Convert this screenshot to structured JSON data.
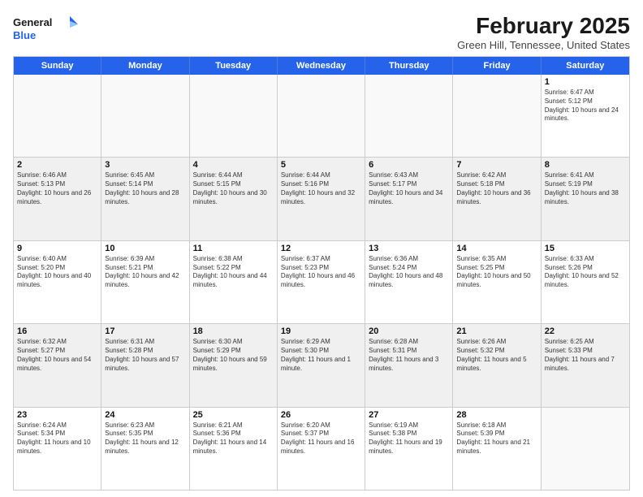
{
  "logo": {
    "general": "General",
    "blue": "Blue"
  },
  "header": {
    "title": "February 2025",
    "location": "Green Hill, Tennessee, United States"
  },
  "weekdays": [
    "Sunday",
    "Monday",
    "Tuesday",
    "Wednesday",
    "Thursday",
    "Friday",
    "Saturday"
  ],
  "rows": [
    [
      {
        "day": "",
        "empty": true
      },
      {
        "day": "",
        "empty": true
      },
      {
        "day": "",
        "empty": true
      },
      {
        "day": "",
        "empty": true
      },
      {
        "day": "",
        "empty": true
      },
      {
        "day": "",
        "empty": true
      },
      {
        "day": "1",
        "sunrise": "6:47 AM",
        "sunset": "5:12 PM",
        "daylight": "10 hours and 24 minutes."
      }
    ],
    [
      {
        "day": "2",
        "sunrise": "6:46 AM",
        "sunset": "5:13 PM",
        "daylight": "10 hours and 26 minutes."
      },
      {
        "day": "3",
        "sunrise": "6:45 AM",
        "sunset": "5:14 PM",
        "daylight": "10 hours and 28 minutes."
      },
      {
        "day": "4",
        "sunrise": "6:44 AM",
        "sunset": "5:15 PM",
        "daylight": "10 hours and 30 minutes."
      },
      {
        "day": "5",
        "sunrise": "6:44 AM",
        "sunset": "5:16 PM",
        "daylight": "10 hours and 32 minutes."
      },
      {
        "day": "6",
        "sunrise": "6:43 AM",
        "sunset": "5:17 PM",
        "daylight": "10 hours and 34 minutes."
      },
      {
        "day": "7",
        "sunrise": "6:42 AM",
        "sunset": "5:18 PM",
        "daylight": "10 hours and 36 minutes."
      },
      {
        "day": "8",
        "sunrise": "6:41 AM",
        "sunset": "5:19 PM",
        "daylight": "10 hours and 38 minutes."
      }
    ],
    [
      {
        "day": "9",
        "sunrise": "6:40 AM",
        "sunset": "5:20 PM",
        "daylight": "10 hours and 40 minutes."
      },
      {
        "day": "10",
        "sunrise": "6:39 AM",
        "sunset": "5:21 PM",
        "daylight": "10 hours and 42 minutes."
      },
      {
        "day": "11",
        "sunrise": "6:38 AM",
        "sunset": "5:22 PM",
        "daylight": "10 hours and 44 minutes."
      },
      {
        "day": "12",
        "sunrise": "6:37 AM",
        "sunset": "5:23 PM",
        "daylight": "10 hours and 46 minutes."
      },
      {
        "day": "13",
        "sunrise": "6:36 AM",
        "sunset": "5:24 PM",
        "daylight": "10 hours and 48 minutes."
      },
      {
        "day": "14",
        "sunrise": "6:35 AM",
        "sunset": "5:25 PM",
        "daylight": "10 hours and 50 minutes."
      },
      {
        "day": "15",
        "sunrise": "6:33 AM",
        "sunset": "5:26 PM",
        "daylight": "10 hours and 52 minutes."
      }
    ],
    [
      {
        "day": "16",
        "sunrise": "6:32 AM",
        "sunset": "5:27 PM",
        "daylight": "10 hours and 54 minutes."
      },
      {
        "day": "17",
        "sunrise": "6:31 AM",
        "sunset": "5:28 PM",
        "daylight": "10 hours and 57 minutes."
      },
      {
        "day": "18",
        "sunrise": "6:30 AM",
        "sunset": "5:29 PM",
        "daylight": "10 hours and 59 minutes."
      },
      {
        "day": "19",
        "sunrise": "6:29 AM",
        "sunset": "5:30 PM",
        "daylight": "11 hours and 1 minute."
      },
      {
        "day": "20",
        "sunrise": "6:28 AM",
        "sunset": "5:31 PM",
        "daylight": "11 hours and 3 minutes."
      },
      {
        "day": "21",
        "sunrise": "6:26 AM",
        "sunset": "5:32 PM",
        "daylight": "11 hours and 5 minutes."
      },
      {
        "day": "22",
        "sunrise": "6:25 AM",
        "sunset": "5:33 PM",
        "daylight": "11 hours and 7 minutes."
      }
    ],
    [
      {
        "day": "23",
        "sunrise": "6:24 AM",
        "sunset": "5:34 PM",
        "daylight": "11 hours and 10 minutes."
      },
      {
        "day": "24",
        "sunrise": "6:23 AM",
        "sunset": "5:35 PM",
        "daylight": "11 hours and 12 minutes."
      },
      {
        "day": "25",
        "sunrise": "6:21 AM",
        "sunset": "5:36 PM",
        "daylight": "11 hours and 14 minutes."
      },
      {
        "day": "26",
        "sunrise": "6:20 AM",
        "sunset": "5:37 PM",
        "daylight": "11 hours and 16 minutes."
      },
      {
        "day": "27",
        "sunrise": "6:19 AM",
        "sunset": "5:38 PM",
        "daylight": "11 hours and 19 minutes."
      },
      {
        "day": "28",
        "sunrise": "6:18 AM",
        "sunset": "5:39 PM",
        "daylight": "11 hours and 21 minutes."
      },
      {
        "day": "",
        "empty": true
      }
    ]
  ]
}
